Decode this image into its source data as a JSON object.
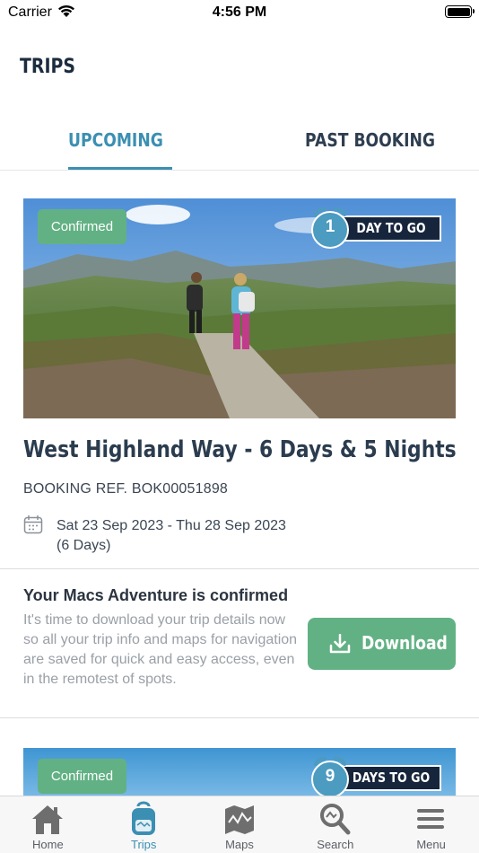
{
  "status_bar": {
    "carrier": "Carrier",
    "time": "4:56 PM"
  },
  "header": {
    "title": "TRIPS"
  },
  "tabs": [
    {
      "label": "UPCOMING",
      "active": true
    },
    {
      "label": "PAST BOOKING",
      "active": false
    }
  ],
  "trips": [
    {
      "status_badge": "Confirmed",
      "days_to_go_number": "1",
      "days_to_go_label": "DAY TO GO",
      "title": "West Highland Way - 6 Days & 5 Nights",
      "booking_ref": "BOOKING REF. BOK00051898",
      "dates": "Sat 23 Sep 2023 - Thu 28 Sep 2023",
      "duration": "(6 Days)",
      "confirm_heading": "Your Macs Adventure is confirmed",
      "confirm_body": "It's time to download your trip details now so all your trip info and maps for navigation are saved for quick and easy access, even in the remotest of spots.",
      "download_label": "Download"
    },
    {
      "status_badge": "Confirmed",
      "days_to_go_number": "9",
      "days_to_go_label": "DAYS TO GO"
    }
  ],
  "bottom_nav": [
    {
      "label": "Home",
      "icon": "home-icon",
      "active": false
    },
    {
      "label": "Trips",
      "icon": "backpack-icon",
      "active": true
    },
    {
      "label": "Maps",
      "icon": "map-icon",
      "active": false
    },
    {
      "label": "Search",
      "icon": "search-icon",
      "active": false
    },
    {
      "label": "Menu",
      "icon": "menu-icon",
      "active": false
    }
  ],
  "colors": {
    "accent": "#3b8fb2",
    "confirmed_green": "#62b184",
    "dark_navy": "#16253b",
    "text_dark": "#2b3c4f",
    "text_muted": "#9aa0a6"
  }
}
